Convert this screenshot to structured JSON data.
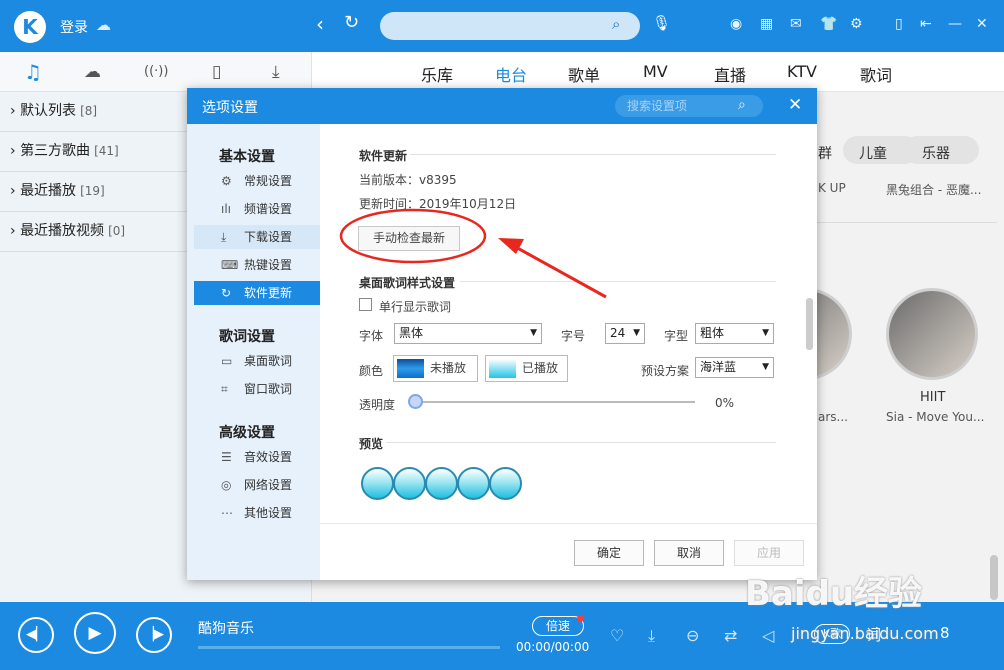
{
  "topbar": {
    "logo": "K",
    "login": "登录"
  },
  "left_tabs": [
    {
      "icon": "♫"
    },
    {
      "icon": "☁"
    },
    {
      "icon": "((·))"
    },
    {
      "icon": "▯"
    },
    {
      "icon": "⤓"
    }
  ],
  "main_tabs": [
    "乐库",
    "电台",
    "歌单",
    "MV",
    "直播",
    "KTV",
    "歌词"
  ],
  "active_main_tab": "电台",
  "playlists": [
    {
      "name": "默认列表",
      "count": "[8]"
    },
    {
      "name": "第三方歌曲",
      "count": "[41]"
    },
    {
      "name": "最近播放",
      "count": "[19]"
    },
    {
      "name": "最近播放视频",
      "count": "[0]"
    }
  ],
  "categories": [
    "群",
    "儿童",
    "乐器"
  ],
  "captions": {
    "left_top": "K UP",
    "right_top": "黑兔组合 - 恶魔...",
    "avatar_title": "HIIT",
    "avatar_sub": "Sia - Move You...",
    "left_mid": "ars..."
  },
  "dialog": {
    "title": "选项设置",
    "search_placeholder": "搜索设置项",
    "groups": [
      {
        "title": "基本设置",
        "items": [
          {
            "icon": "⚙",
            "label": "常规设置"
          },
          {
            "icon": "ılı",
            "label": "频谱设置"
          },
          {
            "icon": "⤓",
            "label": "下载设置"
          },
          {
            "icon": "⌨",
            "label": "热键设置"
          },
          {
            "icon": "↻",
            "label": "软件更新",
            "active": true
          }
        ]
      },
      {
        "title": "歌词设置",
        "items": [
          {
            "icon": "▭",
            "label": "桌面歌词"
          },
          {
            "icon": "⌗",
            "label": "窗口歌词"
          }
        ]
      },
      {
        "title": "高级设置",
        "items": [
          {
            "icon": "☰",
            "label": "音效设置"
          },
          {
            "icon": "◎",
            "label": "网络设置"
          },
          {
            "icon": "⋯",
            "label": "其他设置"
          }
        ]
      }
    ],
    "update": {
      "section_title": "软件更新",
      "version_label": "当前版本：v8395",
      "date_label": "更新时间：2019年10月12日",
      "check_button": "手动检查最新"
    },
    "lyrics_style": {
      "section_title": "桌面歌词样式设置",
      "single_line_label": "单行显示歌词",
      "single_line_checked": false,
      "font_label": "字体",
      "font_value": "黑体",
      "size_label": "字号",
      "size_value": "24",
      "weight_label": "字型",
      "weight_value": "粗体",
      "color_label": "颜色",
      "unplayed_label": "未播放",
      "played_label": "已播放",
      "preset_label": "预设方案",
      "preset_value": "海洋蓝",
      "opacity_label": "透明度",
      "opacity_value": "0%",
      "colors": {
        "unplayed": "#0d6fc8",
        "played": "#22c4e8"
      }
    },
    "preview": {
      "section_title": "预览",
      "circles": 5
    },
    "footer": {
      "ok": "确定",
      "cancel": "取消",
      "apply": "应用"
    }
  },
  "player": {
    "title": "酷狗音乐",
    "speed": "倍速",
    "time": "00:00/00:00",
    "lyric_btn": "K歌",
    "ci": "词",
    "list_count": "8",
    "progress": 0
  },
  "watermark": {
    "main": "Baidu经验",
    "sub": "jingyan.baidu.com"
  },
  "colors": {
    "accent": "#1b8ae0",
    "annotation": "#e8281e"
  }
}
